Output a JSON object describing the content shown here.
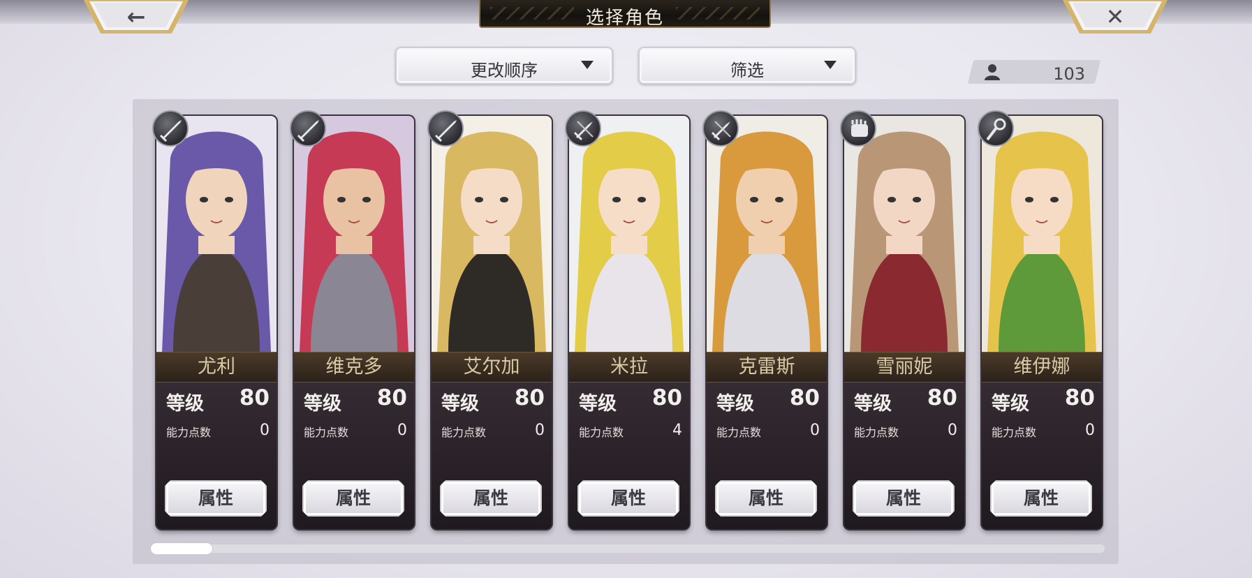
{
  "header": {
    "title": "选择角色",
    "back_glyph": "←",
    "close_glyph": "✕"
  },
  "controls": {
    "sort_label": "更改顺序",
    "filter_label": "筛选",
    "character_count": "103"
  },
  "stats_labels": {
    "level": "等级",
    "ability_points": "能力点数",
    "attributes_button": "属性"
  },
  "characters": [
    {
      "name": "尤利",
      "level": "80",
      "ability_points": "0",
      "weapon_icon": "sword-icon",
      "hair": "#6a58a8",
      "bg": "#e8e4f0",
      "skin": "#f0d4bc",
      "outfit": "#4a3e38"
    },
    {
      "name": "维克多",
      "level": "80",
      "ability_points": "0",
      "weapon_icon": "sword-icon",
      "hair": "#c63a56",
      "bg": "#d6c8de",
      "skin": "#e8c2a2",
      "outfit": "#8a8694"
    },
    {
      "name": "艾尔加",
      "level": "80",
      "ability_points": "0",
      "weapon_icon": "sword-icon",
      "hair": "#d8b860",
      "bg": "#f4f0e8",
      "skin": "#f4dcc6",
      "outfit": "#2e2a26"
    },
    {
      "name": "米拉",
      "level": "80",
      "ability_points": "4",
      "weapon_icon": "dagger-icon",
      "hair": "#e2cc48",
      "bg": "#eef0f2",
      "skin": "#f6ddc8",
      "outfit": "#e8e4ea"
    },
    {
      "name": "克雷斯",
      "level": "80",
      "ability_points": "0",
      "weapon_icon": "dagger-icon",
      "hair": "#d89a3c",
      "bg": "#f0ece6",
      "skin": "#f0cfae",
      "outfit": "#dcdce2"
    },
    {
      "name": "雪丽妮",
      "level": "80",
      "ability_points": "0",
      "weapon_icon": "gauntlet-icon",
      "hair": "#b89676",
      "bg": "#eae6e2",
      "skin": "#f2d8c4",
      "outfit": "#8a2a30"
    },
    {
      "name": "维伊娜",
      "level": "80",
      "ability_points": "0",
      "weapon_icon": "staff-icon",
      "hair": "#e6c44c",
      "bg": "#eee8dc",
      "skin": "#f6dcc4",
      "outfit": "#5e9a3a"
    }
  ]
}
